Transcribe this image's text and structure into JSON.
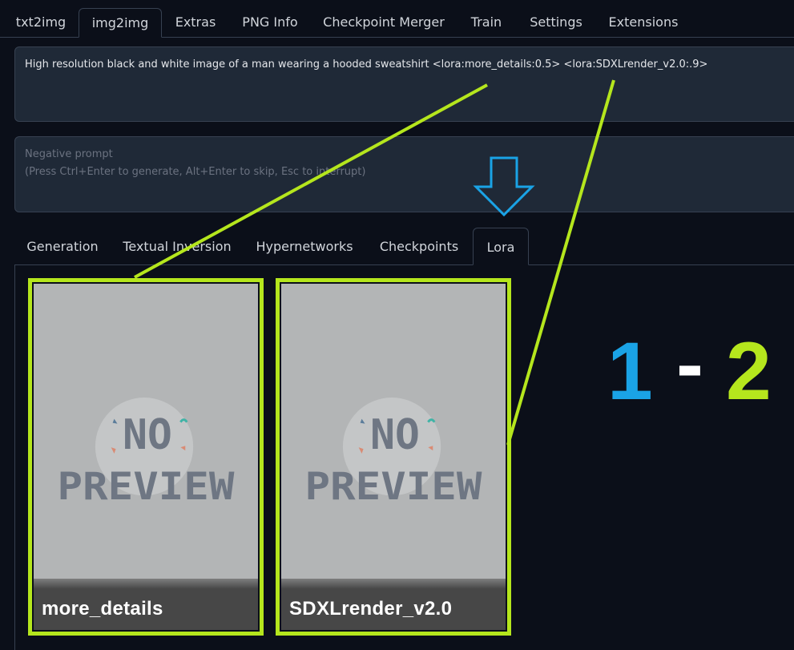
{
  "top_tabs": [
    "txt2img",
    "img2img",
    "Extras",
    "PNG Info",
    "Checkpoint Merger",
    "Train",
    "Settings",
    "Extensions"
  ],
  "top_tabs_active": "img2img",
  "prompt": {
    "value": "High resolution black and white image of a man wearing a hooded sweatshirt <lora:more_details:0.5> <lora:SDXLrender_v2.0:.9>"
  },
  "negative_prompt": {
    "placeholder_line1": "Negative prompt",
    "placeholder_line2": "(Press Ctrl+Enter to generate, Alt+Enter to skip, Esc to interrupt)"
  },
  "sub_tabs": [
    "Generation",
    "Textual Inversion",
    "Hypernetworks",
    "Checkpoints",
    "Lora"
  ],
  "sub_tabs_active": "Lora",
  "cards": [
    {
      "name": "more_details",
      "preview_line1": "NO",
      "preview_line2": "PREVIEW"
    },
    {
      "name": "SDXLrender_v2.0",
      "preview_line1": "NO",
      "preview_line2": "PREVIEW"
    }
  ],
  "annotation": {
    "num1": "1",
    "dash": "-",
    "num2": "2",
    "num1_color": "#1aa3e6",
    "dash_color": "#ffffff",
    "num2_color": "#b5e61d",
    "arrow_color": "#1aa3e6",
    "line_color": "#b5e61d"
  },
  "colors": {
    "background": "#0b0f19",
    "panel": "#1f2937",
    "border": "#374151",
    "highlight": "#b5e61d"
  }
}
